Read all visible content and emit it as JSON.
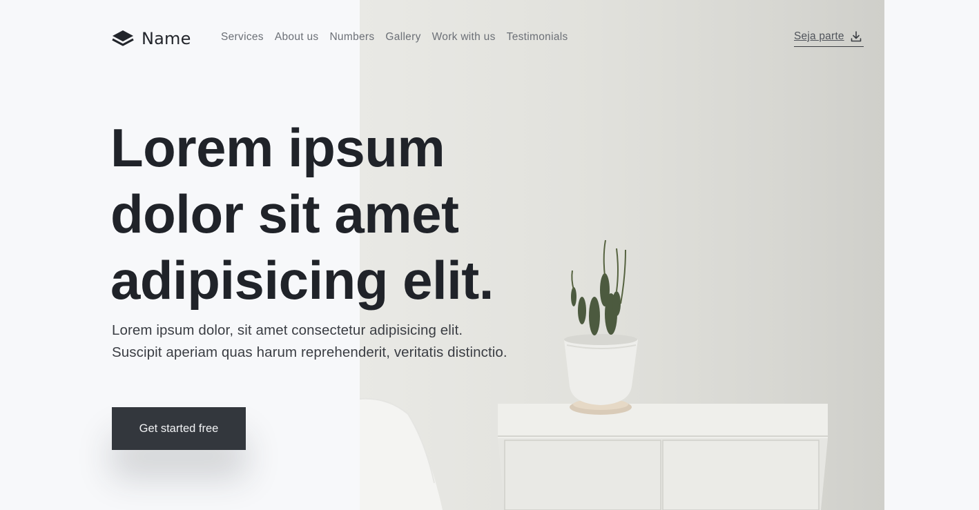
{
  "brand": {
    "name": "Name",
    "logo_icon": "layers-icon"
  },
  "nav": {
    "items": [
      "Services",
      "About us",
      "Numbers",
      "Gallery",
      "Work with us",
      "Testimonials"
    ]
  },
  "header_cta": {
    "label": "Seja parte",
    "icon": "download-icon"
  },
  "hero": {
    "headline_lines": [
      "Lorem ipsum",
      "dolor sit amet",
      "adipisicing elit."
    ],
    "subtitle_lines": [
      "Lorem ipsum dolor, sit amet consectetur adipisicing elit.",
      "Suscipit aperiam quas harum reprehenderit, veritatis distinctio."
    ],
    "button_label": "Get started free"
  },
  "colors": {
    "background": "#f7f8fa",
    "text_dark": "#22252b",
    "nav_text": "#6b6f76",
    "button_bg": "#33373d",
    "button_text": "#f2f3f5"
  }
}
